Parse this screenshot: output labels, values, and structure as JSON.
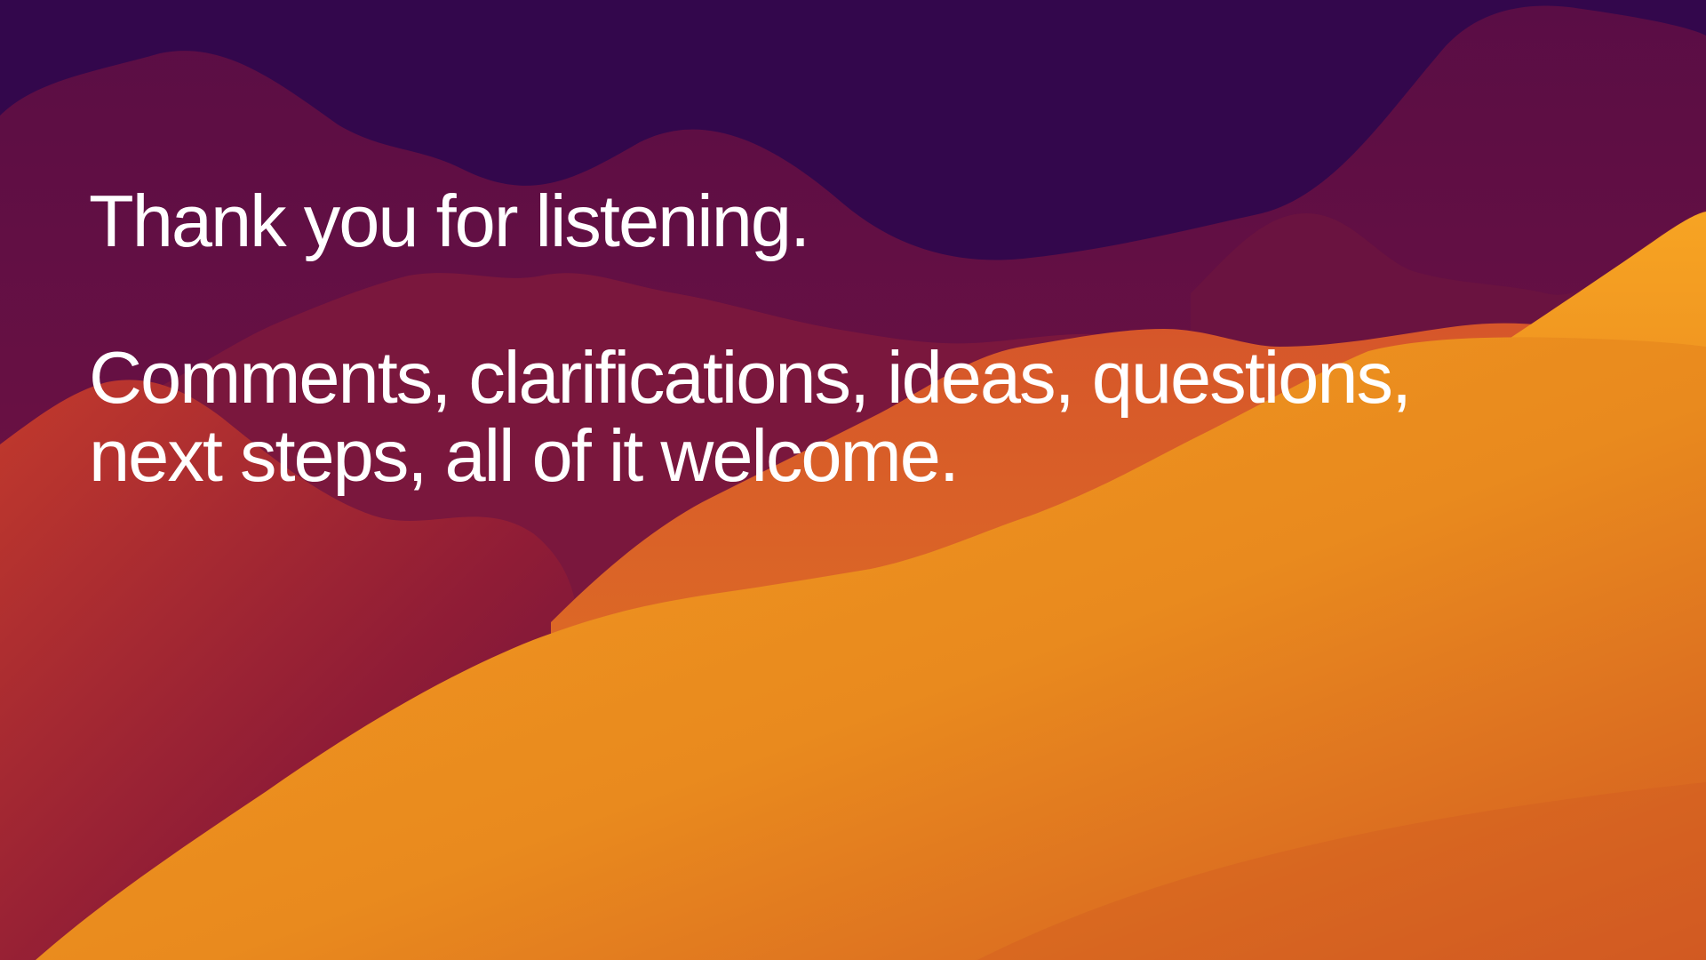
{
  "slide": {
    "title": "Thank you for listening.",
    "body": "Comments, clarifications, ideas, questions,\nnext steps, all of it welcome."
  },
  "colors": {
    "sky": "#33074c",
    "dark_hill": "#4e0c47",
    "mid_hill": "#6d1140",
    "red_hill": "#a02a2e",
    "orange_hill": "#e2741e",
    "light_orange": "#f09a20",
    "text": "#ffffff"
  }
}
